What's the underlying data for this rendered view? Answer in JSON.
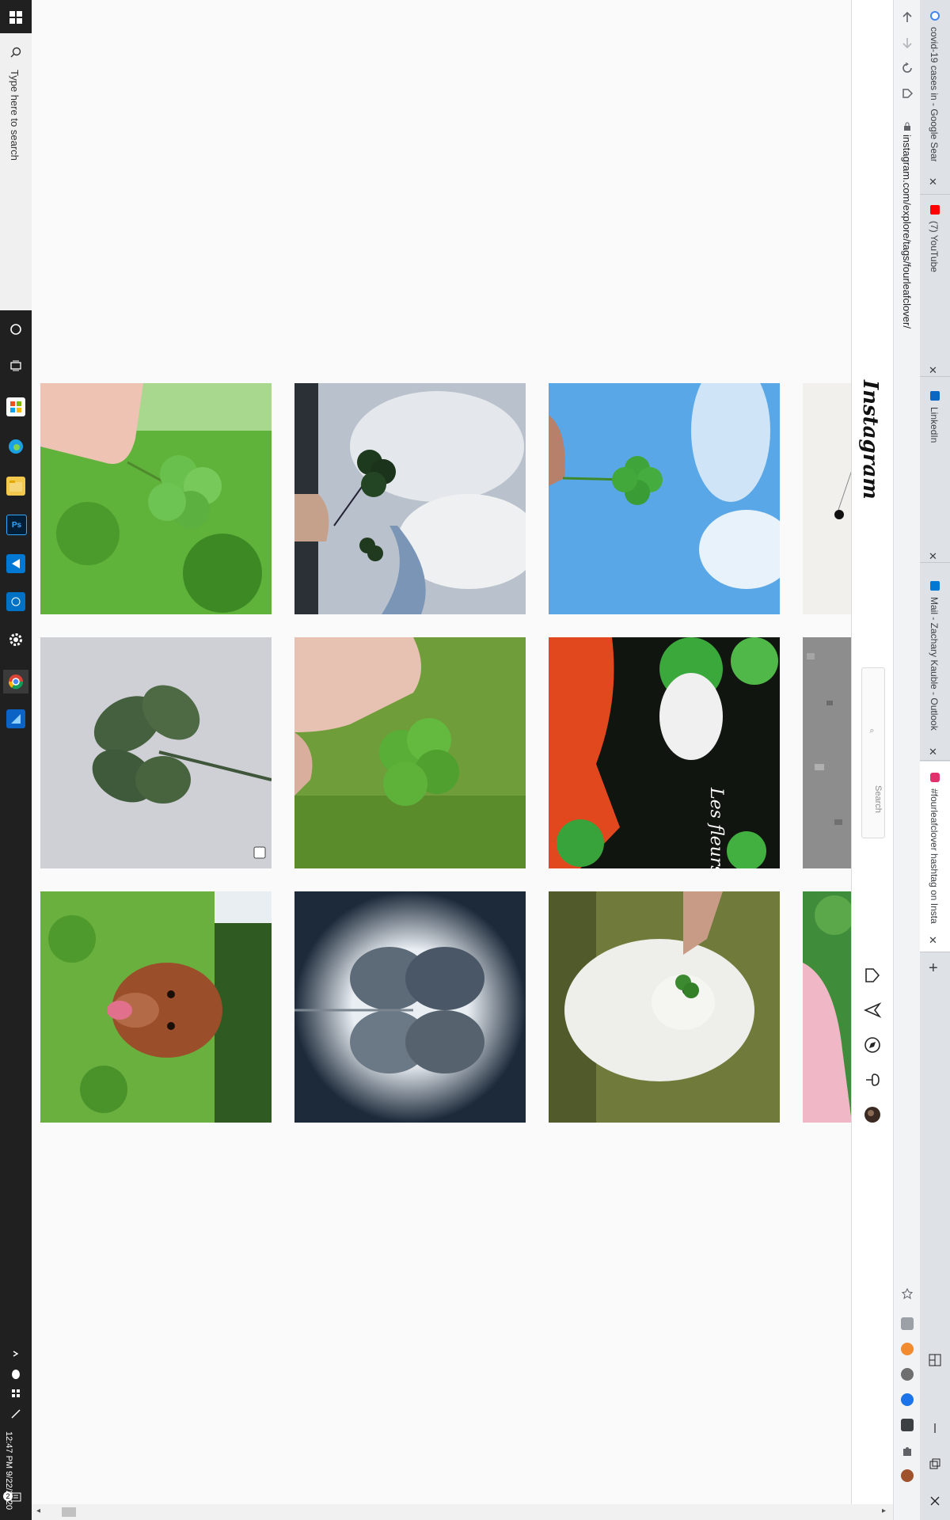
{
  "taskbar": {
    "search_placeholder": "Type here to search",
    "time": "12:47 PM",
    "date": "9/22/2020",
    "notification_count": "2"
  },
  "browser": {
    "url": "instagram.com/explore/tags/fourleafclover/",
    "tabs": [
      {
        "title": "covid-19 cases in - Google Searc",
        "favicon_color": "#4285f4"
      },
      {
        "title": "(7) YouTube",
        "favicon_color": "#ff0000"
      },
      {
        "title": "LinkedIn",
        "favicon_color": "#0a66c2"
      },
      {
        "title": "Mail - Zachary Kauble - Outlook",
        "favicon_color": "#0078d4"
      },
      {
        "title": "#fourleafclover hashtag on Insta",
        "favicon_color": "#e1306c"
      }
    ]
  },
  "instagram": {
    "logo": "Instagram",
    "search_placeholder": "Search"
  }
}
